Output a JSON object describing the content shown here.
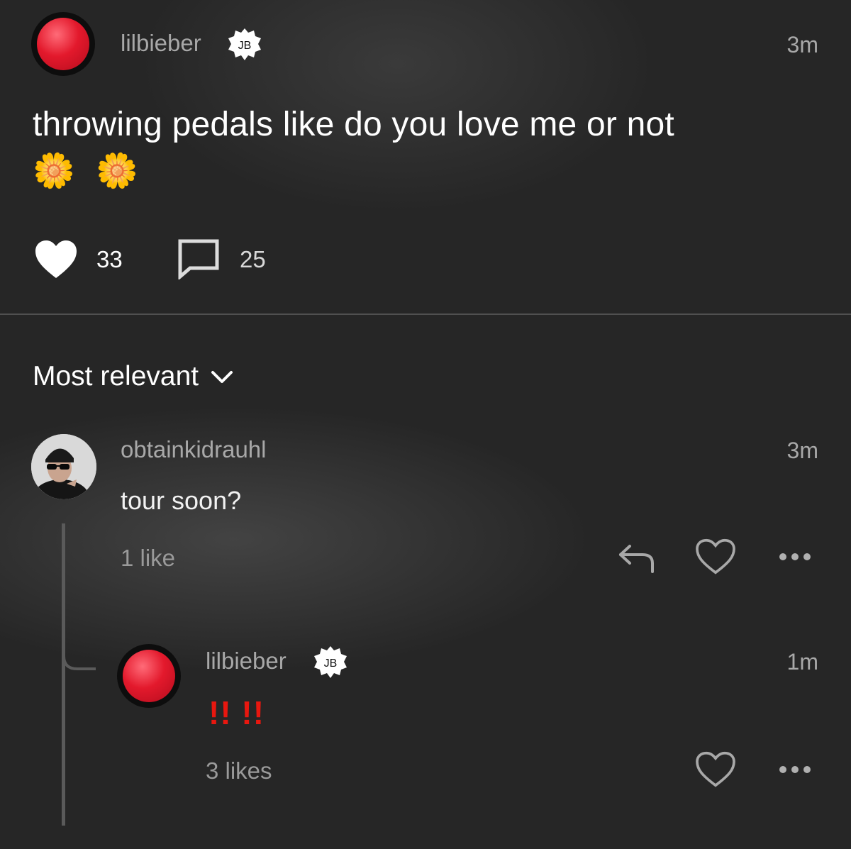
{
  "post": {
    "username": "lilbieber",
    "badge_text": "JB",
    "time": "3m",
    "text": "throwing pedals like do you love me or not",
    "emojis": "🌼 🌼",
    "likes_count": "33",
    "comments_count": "25"
  },
  "sort": {
    "label": "Most relevant"
  },
  "comments": [
    {
      "username": "obtainkidrauhl",
      "time": "3m",
      "text": "tour soon?",
      "likes": "1 like"
    }
  ],
  "reply": {
    "username": "lilbieber",
    "badge_text": "JB",
    "time": "1m",
    "text": "!! !!",
    "likes": "3 likes"
  },
  "colors": {
    "background": "#262626",
    "muted_text": "#a8a8a8",
    "accent_red": "#e8170f"
  },
  "icons": [
    "verified-badge-icon",
    "heart-filled-icon",
    "comment-icon",
    "chevron-down-icon",
    "reply-icon",
    "heart-outline-icon",
    "more-icon"
  ]
}
